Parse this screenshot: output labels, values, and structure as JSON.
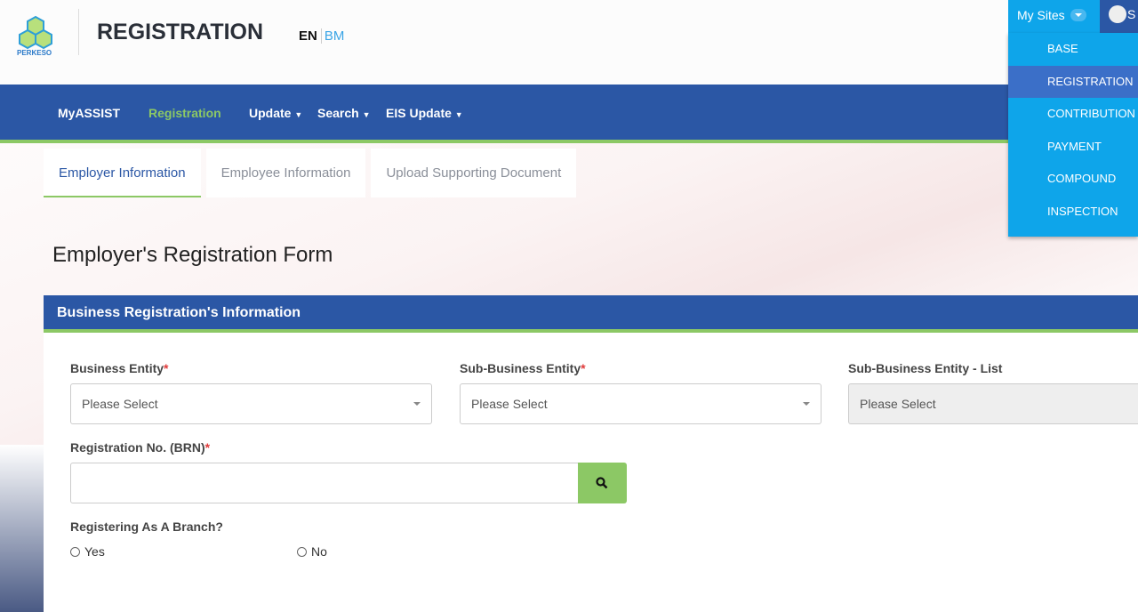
{
  "header": {
    "logo_text": "PERKESO",
    "title": "REGISTRATION",
    "lang": {
      "en": "EN",
      "bm": "BM"
    }
  },
  "top_right": {
    "my_sites": "My Sites",
    "user_initial": "S",
    "menu": [
      "BASE",
      "REGISTRATION",
      "CONTRIBUTION",
      "PAYMENT",
      "COMPOUND",
      "INSPECTION"
    ],
    "selected": "REGISTRATION"
  },
  "nav": {
    "items": [
      "MyASSIST",
      "Registration",
      "Update",
      "Search",
      "EIS Update"
    ],
    "active": "Registration"
  },
  "tabs": [
    "Employer Information",
    "Employee Information",
    "Upload Supporting Document"
  ],
  "form": {
    "title": "Employer's Registration Form",
    "section": "Business Registration's Information",
    "business_entity": {
      "label": "Business Entity",
      "value": "Please Select"
    },
    "sub_business_entity": {
      "label": "Sub-Business Entity",
      "value": "Please Select"
    },
    "sub_business_entity_list": {
      "label": "Sub-Business Entity - List",
      "value": "Please Select"
    },
    "brn": {
      "label": "Registration No. (BRN)",
      "value": ""
    },
    "branch": {
      "label": "Registering As A Branch?",
      "yes": "Yes",
      "no": "No"
    },
    "required_mark": "*"
  },
  "colors": {
    "primary": "#2b57a5",
    "accent": "#8cc865",
    "menu": "#0ea5ea"
  }
}
